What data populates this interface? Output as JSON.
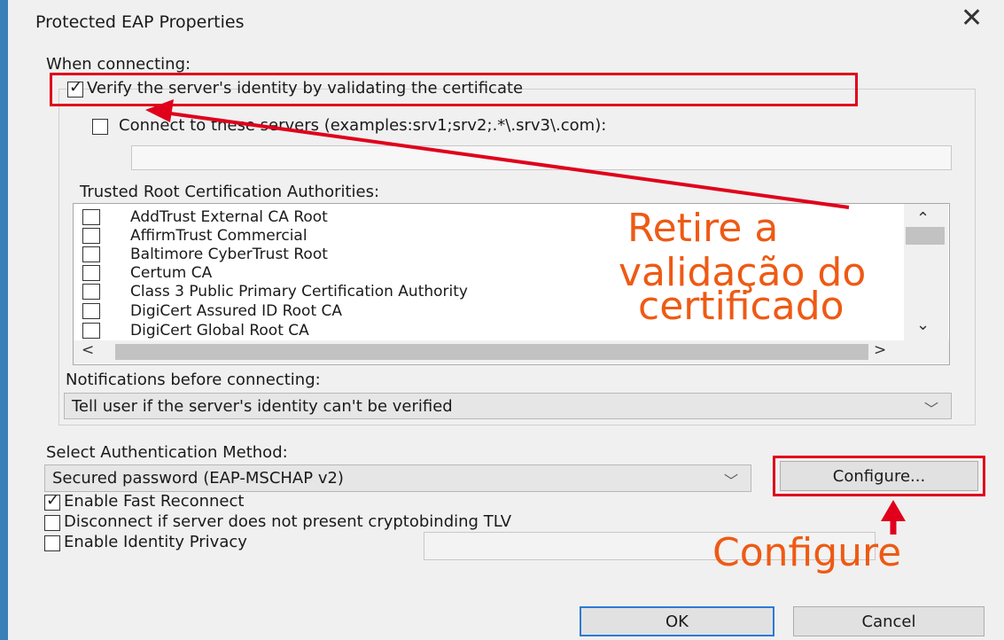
{
  "dialog": {
    "title": "Protected EAP Properties",
    "close_glyph": "✕"
  },
  "when_connecting": {
    "label": "When connecting:",
    "verify_label": "Verify the server's identity by validating the certificate",
    "verify_checked": true,
    "connect_label": "Connect to these servers (examples:srv1;srv2;.*\\.srv3\\.com):",
    "connect_checked": false,
    "servers_value": ""
  },
  "trusted_roots": {
    "label": "Trusted Root Certification Authorities:",
    "items": [
      {
        "name": "AddTrust External CA Root",
        "checked": false
      },
      {
        "name": "AffirmTrust Commercial",
        "checked": false
      },
      {
        "name": "Baltimore CyberTrust Root",
        "checked": false
      },
      {
        "name": "Certum CA",
        "checked": false
      },
      {
        "name": "Class 3 Public Primary Certification Authority",
        "checked": false
      },
      {
        "name": "DigiCert Assured ID Root CA",
        "checked": false
      },
      {
        "name": "DigiCert Global Root CA",
        "checked": false
      }
    ],
    "scroll_up": "⌃",
    "scroll_down": "⌄",
    "scroll_left": "<",
    "scroll_right": ">"
  },
  "notifications": {
    "label": "Notifications before connecting:",
    "selected": "Tell user if the server's identity can't be verified"
  },
  "auth": {
    "label": "Select Authentication Method:",
    "selected": "Secured password (EAP-MSCHAP v2)",
    "configure_label": "Configure..."
  },
  "options": [
    {
      "label": "Enable Fast Reconnect",
      "checked": true
    },
    {
      "label": "Disconnect if server does not present cryptobinding TLV",
      "checked": false
    },
    {
      "label": "Enable Identity Privacy",
      "checked": false
    }
  ],
  "identity_privacy_value": "",
  "footer": {
    "ok_label": "OK",
    "cancel_label": "Cancel"
  },
  "annotations": {
    "retire_line1": "Retire a",
    "retire_line2": "validação do",
    "retire_line3": "certificado",
    "configure_note": "Configure",
    "annotation_color": "#ee5a14",
    "highlight_color": "#e0001b"
  },
  "icons": {
    "chevron": "chevron-down-icon",
    "check": "checkmark-icon",
    "close": "close-icon"
  }
}
